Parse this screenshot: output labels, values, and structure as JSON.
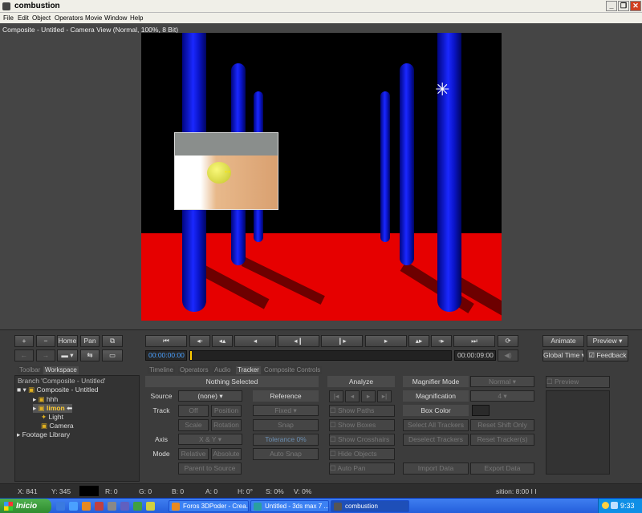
{
  "window": {
    "title": "combustion"
  },
  "menu": [
    "File",
    "Edit",
    "Object",
    "Operators",
    "Movie",
    "Window",
    "Help"
  ],
  "viewer": {
    "title": "Composite - Untitled - Camera View (Normal, 100%, 8 Bit)"
  },
  "transport": {
    "plus": "+",
    "minus": "−",
    "home": "Home",
    "pan": "Pan",
    "start_time": "00:00:00:00",
    "end_time": "00:00:09:00",
    "animate": "Animate",
    "preview": "Preview",
    "global_time": "Global Time",
    "feedback": "Feedback"
  },
  "tabs": [
    "Toolbar",
    "Workspace",
    "Timeline",
    "Operators",
    "Audio",
    "Tracker",
    "Composite Controls"
  ],
  "workspace": {
    "branch": "Branch 'Composite - Untitled'",
    "composite": "Composite - Untitled",
    "layer1": "hhh",
    "layer2": "limon",
    "light": "Light",
    "camera": "Camera",
    "footage": "Footage Library"
  },
  "tracker": {
    "selection": "Nothing Selected",
    "source_label": "Source",
    "source_value": "(none)",
    "reference": "Reference",
    "track_label": "Track",
    "off": "Off",
    "position": "Position",
    "fixed": "Fixed",
    "scale": "Scale",
    "rotation": "Rotation",
    "snap": "Snap",
    "axis_label": "Axis",
    "axis_value": "X & Y",
    "tolerance": "Tolerance 0%",
    "mode_label": "Mode",
    "relative": "Relative",
    "absolute": "Absolute",
    "auto_snap": "Auto Snap",
    "parent_to_source": "Parent to Source",
    "analyze": "Analyze",
    "show_paths": "Show Paths",
    "show_boxes": "Show Boxes",
    "show_crosshairs": "Show Crosshairs",
    "hide_objects": "Hide Objects",
    "auto_pan": "Auto Pan",
    "magnifier_mode": "Magnifier Mode",
    "magnifier_value": "Normal",
    "magnification": "Magnification",
    "magnification_value": "4",
    "box_color": "Box Color",
    "select_all": "Select All Trackers",
    "reset_shift": "Reset Shift Only",
    "deselect": "Deselect Trackers",
    "reset_trackers": "Reset Tracker(s)",
    "import_data": "Import Data",
    "export_data": "Export Data",
    "preview": "Preview"
  },
  "status": {
    "x": "X:   841",
    "y": "Y:   345",
    "r": "R: 0",
    "g": "G: 0",
    "b": "B: 0",
    "a": "A: 0",
    "h": "H: 0°",
    "s": "S: 0%",
    "v": "V: 0%",
    "position": "sition: 8:00  I I"
  },
  "taskbar": {
    "start": "Inicio",
    "task1": "Foros 3DPoder - Crea...",
    "task2": "Untitled - 3ds max 7 ...",
    "task3": "combustion",
    "clock": "9:33"
  },
  "colors": {
    "accent": "#4aa0ff",
    "floor": "#e60000",
    "pillar": "#1a28ff",
    "xp_taskbar": "#245edb",
    "xp_start": "#3c9a3c"
  }
}
